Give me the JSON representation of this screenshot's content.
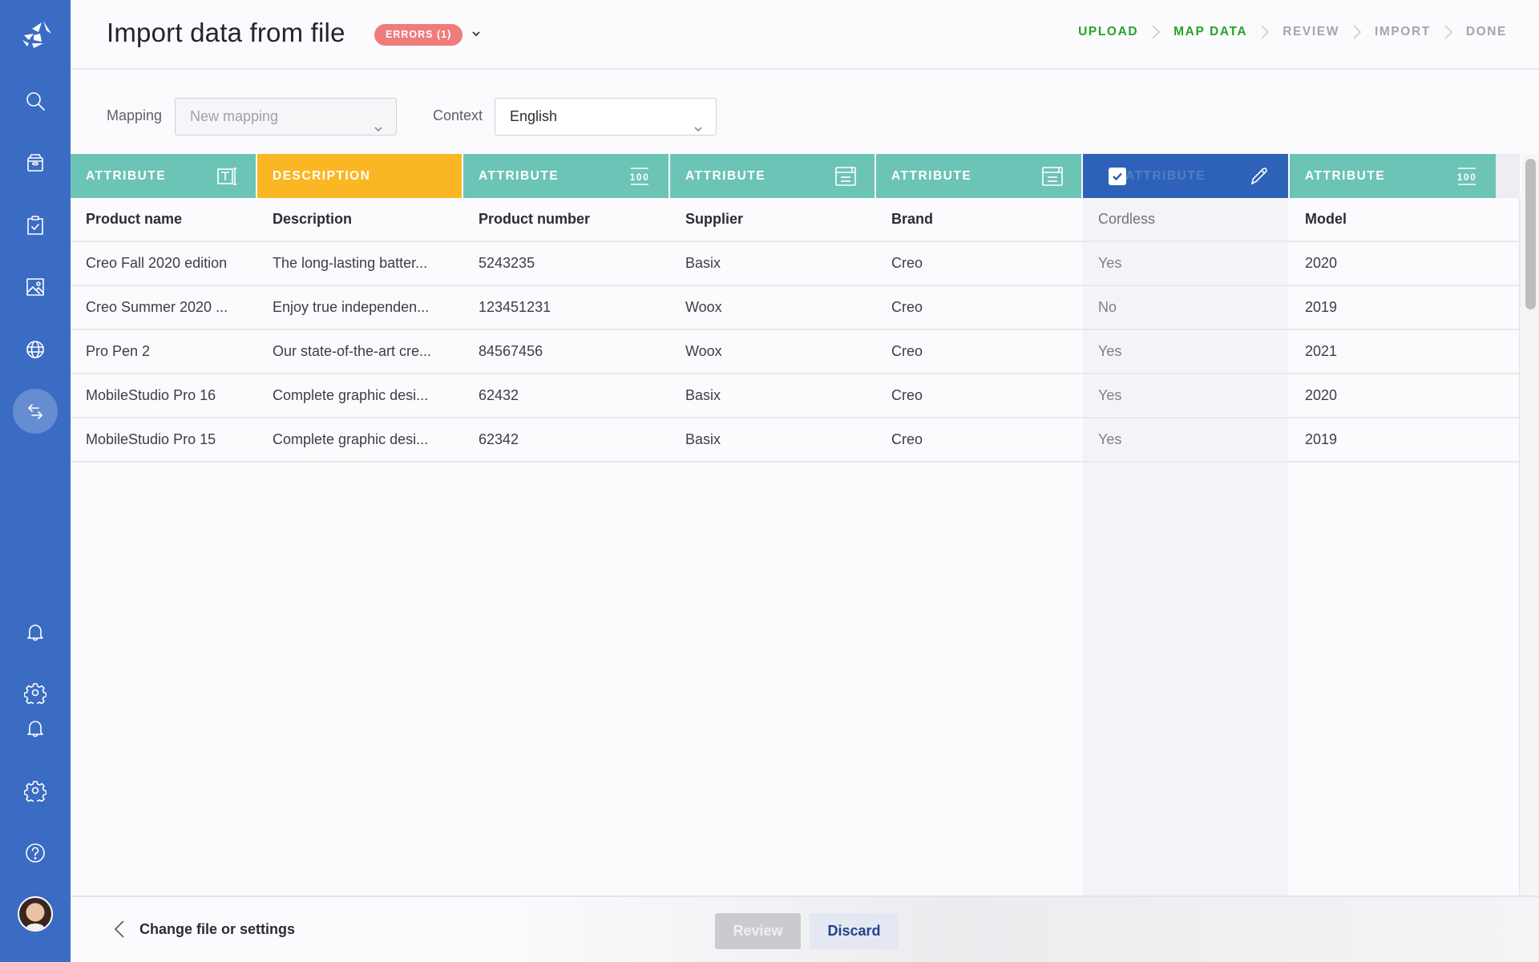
{
  "sidebar": {
    "logo": "app-logo",
    "items": [
      {
        "name": "search",
        "icon": "search-icon"
      },
      {
        "name": "products",
        "icon": "box-icon"
      },
      {
        "name": "tasks",
        "icon": "clipboard-check-icon"
      },
      {
        "name": "assets",
        "icon": "image-icon"
      },
      {
        "name": "channels",
        "icon": "globe-icon"
      },
      {
        "name": "import-export",
        "icon": "arrows-swap-icon",
        "active": true
      }
    ],
    "bottom_items": [
      {
        "name": "notifications",
        "icon": "bell-icon"
      },
      {
        "name": "settings",
        "icon": "gear-icon"
      },
      {
        "name": "notifications-2",
        "icon": "bell-icon"
      },
      {
        "name": "settings-2",
        "icon": "gear-icon"
      },
      {
        "name": "help",
        "icon": "question-icon"
      }
    ],
    "avatar": "user-avatar"
  },
  "header": {
    "title": "Import data from file",
    "errors_badge": "ERRORS (1)",
    "steps": [
      {
        "label": "UPLOAD",
        "state": "done"
      },
      {
        "label": "MAP DATA",
        "state": "current"
      },
      {
        "label": "REVIEW",
        "state": "pending"
      },
      {
        "label": "IMPORT",
        "state": "pending"
      },
      {
        "label": "DONE",
        "state": "pending"
      }
    ]
  },
  "filters": {
    "mapping_label": "Mapping",
    "mapping_placeholder": "New mapping",
    "context_label": "Context",
    "context_value": "English"
  },
  "colors": {
    "sidebar": "#3b6cc4",
    "attribute_header": "#6cc4b6",
    "description_header": "#fbb723",
    "selected_header": "#2d62b8",
    "step_done": "#2aa22a",
    "error_badge": "#f07b7b"
  },
  "table": {
    "column_headers": [
      {
        "label": "ATTRIBUTE",
        "type": "attribute",
        "icon": "text-type-icon"
      },
      {
        "label": "DESCRIPTION",
        "type": "description",
        "icon": ""
      },
      {
        "label": "ATTRIBUTE",
        "type": "attribute",
        "icon": "number-type-icon"
      },
      {
        "label": "ATTRIBUTE",
        "type": "attribute",
        "icon": "list-type-icon"
      },
      {
        "label": "ATTRIBUTE",
        "type": "attribute",
        "icon": "list-type-icon"
      },
      {
        "label": "ATTRIBUTE",
        "type": "selected",
        "icon": "pencil-icon",
        "checked": true
      },
      {
        "label": "ATTRIBUTE",
        "type": "attribute",
        "icon": "number-type-icon"
      }
    ],
    "field_names": [
      "Product name",
      "Description",
      "Product number",
      "Supplier",
      "Brand",
      "Cordless",
      "Model"
    ],
    "rows": [
      [
        "Creo Fall 2020 edition",
        "The long-lasting batter...",
        "5243235",
        "Basix",
        "Creo",
        "Yes",
        "2020"
      ],
      [
        "Creo Summer 2020 ...",
        "Enjoy true independen...",
        "123451231",
        "Woox",
        "Creo",
        "No",
        "2019"
      ],
      [
        "Pro Pen 2",
        "Our state-of-the-art cre...",
        "84567456",
        "Woox",
        "Creo",
        "Yes",
        "2021"
      ],
      [
        "MobileStudio Pro 16",
        "Complete graphic desi...",
        "62432",
        "Basix",
        "Creo",
        "Yes",
        "2020"
      ],
      [
        "MobileStudio Pro 15",
        "Complete graphic desi...",
        "62342",
        "Basix",
        "Creo",
        "Yes",
        "2019"
      ]
    ]
  },
  "footer": {
    "back_label": "Change file or settings",
    "review_label": "Review",
    "discard_label": "Discard"
  }
}
